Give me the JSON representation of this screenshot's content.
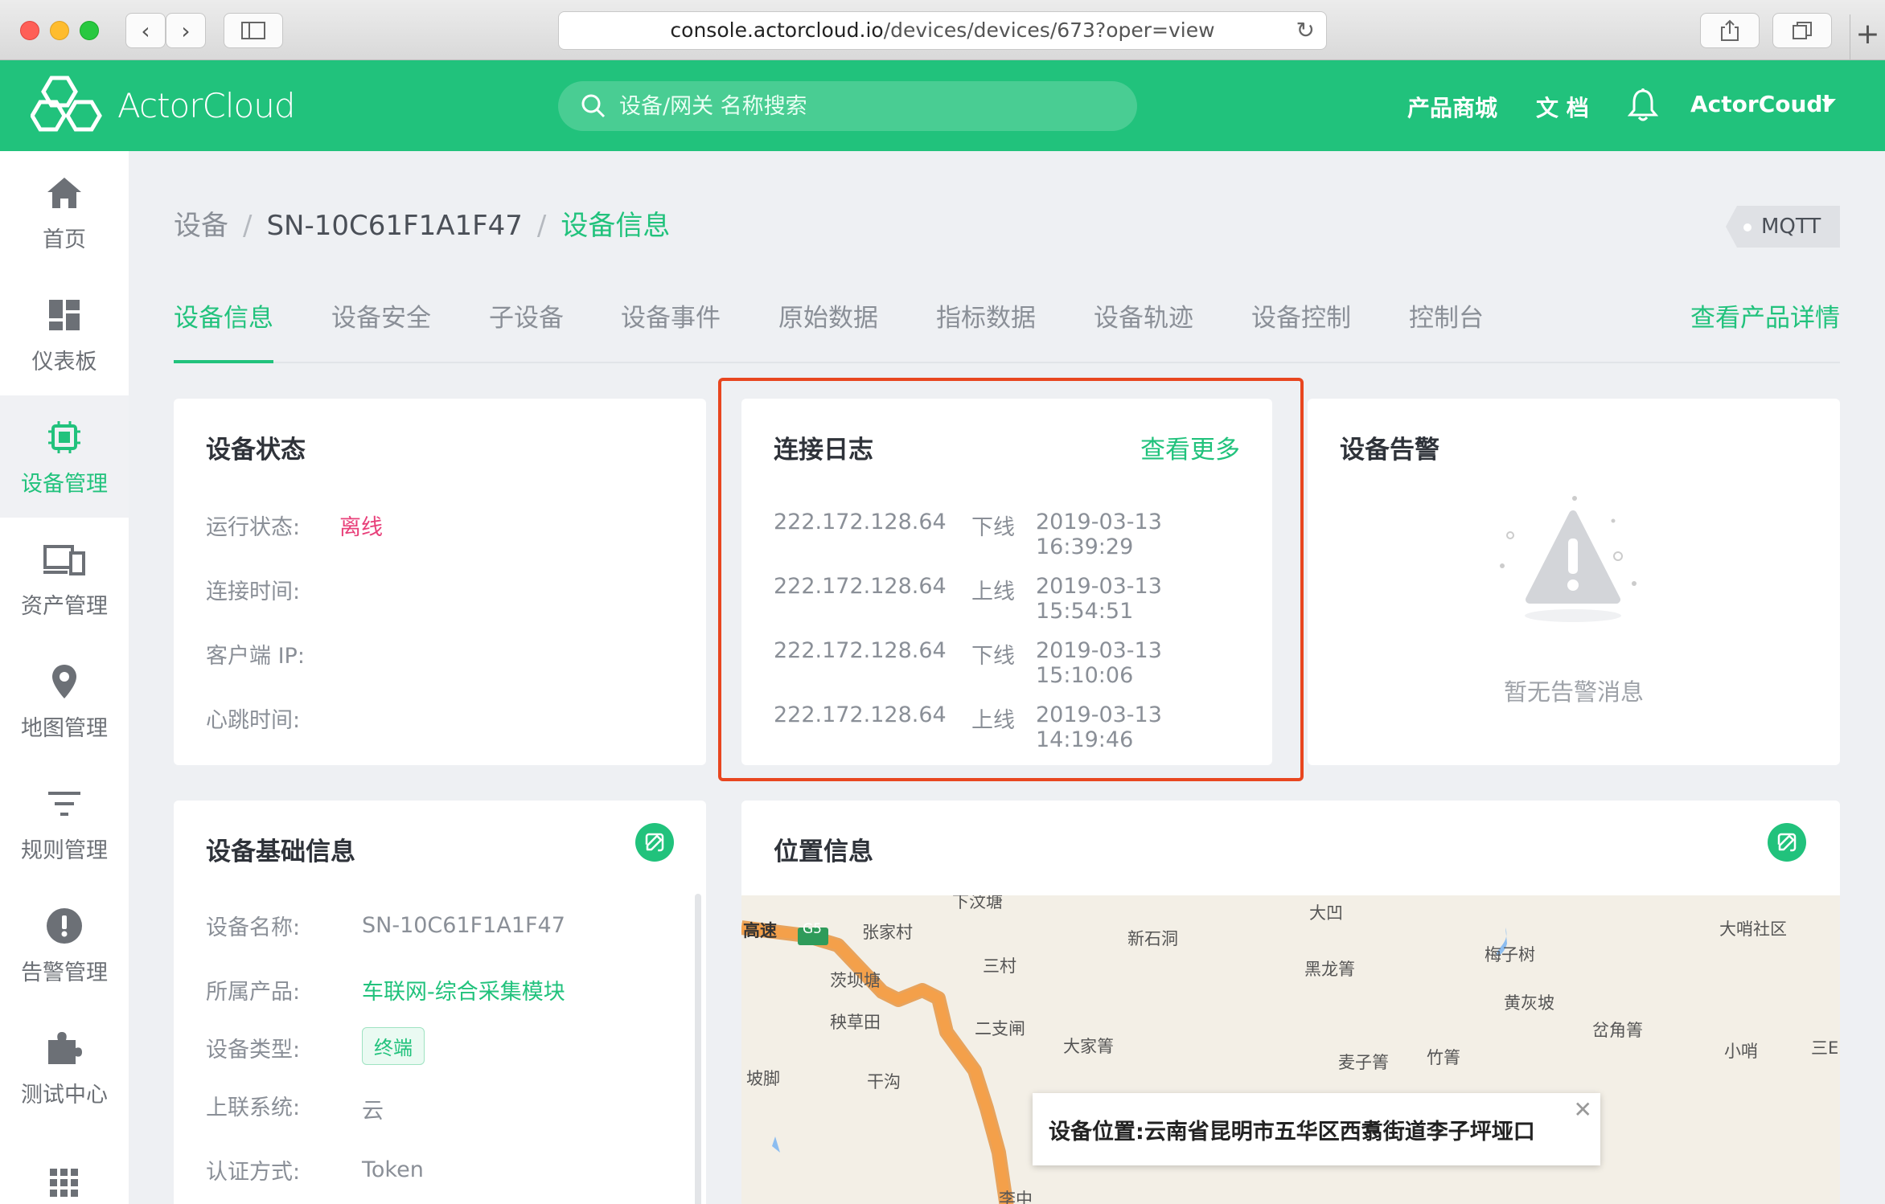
{
  "browser": {
    "url_host": "console.actorcloud.io",
    "url_path": "/devices/devices/673?oper=view"
  },
  "header": {
    "logo_text": "ActorCloud",
    "search_placeholder": "设备/网关 名称搜索",
    "links": [
      "产品商城",
      "文 档"
    ],
    "username": "ActorCoudl"
  },
  "sidebar": {
    "items": [
      {
        "label": "首页",
        "icon": "home-icon"
      },
      {
        "label": "仪表板",
        "icon": "dashboard-icon"
      },
      {
        "label": "设备管理",
        "icon": "chip-icon"
      },
      {
        "label": "资产管理",
        "icon": "devices-icon"
      },
      {
        "label": "地图管理",
        "icon": "map-pin-icon"
      },
      {
        "label": "规则管理",
        "icon": "filter-icon"
      },
      {
        "label": "告警管理",
        "icon": "alert-icon"
      },
      {
        "label": "测试中心",
        "icon": "puzzle-icon"
      },
      {
        "label": "",
        "icon": "grid-icon"
      }
    ]
  },
  "breadcrumb": {
    "root": "设备",
    "sep": "/",
    "device": "SN-10C61F1A1F47",
    "current": "设备信息"
  },
  "protocol_badge": "MQTT",
  "tabs": [
    "设备信息",
    "设备安全",
    "子设备",
    "设备事件",
    "原始数据",
    "指标数据",
    "设备轨迹",
    "设备控制",
    "控制台"
  ],
  "tab_right": "查看产品详情",
  "status_card": {
    "title": "设备状态",
    "rows": [
      {
        "label": "运行状态:",
        "value": "离线"
      },
      {
        "label": "连接时间:",
        "value": ""
      },
      {
        "label": "客户端 IP:",
        "value": ""
      },
      {
        "label": "心跳时间:",
        "value": ""
      }
    ]
  },
  "log_card": {
    "title": "连接日志",
    "more": "查看更多",
    "rows": [
      {
        "ip": "222.172.128.64",
        "status": "下线",
        "time": "2019-03-13 16:39:29"
      },
      {
        "ip": "222.172.128.64",
        "status": "上线",
        "time": "2019-03-13 15:54:51"
      },
      {
        "ip": "222.172.128.64",
        "status": "下线",
        "time": "2019-03-13 15:10:06"
      },
      {
        "ip": "222.172.128.64",
        "status": "上线",
        "time": "2019-03-13 14:19:46"
      }
    ]
  },
  "alert_card": {
    "title": "设备告警",
    "empty_text": "暂无告警消息"
  },
  "basic_card": {
    "title": "设备基础信息",
    "rows": [
      {
        "label": "设备名称:",
        "value": "SN-10C61F1A1F47"
      },
      {
        "label": "所属产品:",
        "value": "车联网-综合采集模块"
      },
      {
        "label": "设备类型:",
        "value": "终端"
      },
      {
        "label": "上联系统:",
        "value": "云"
      },
      {
        "label": "认证方式:",
        "value": "Token"
      }
    ]
  },
  "location_card": {
    "title": "位置信息",
    "popup_label": "设备位置:",
    "popup_value": "云南省昆明市五华区西翥街道李子坪垭口",
    "map_labels": [
      "下汶塘",
      "大凹",
      "大哨社区",
      "高速",
      "G5",
      "张家村",
      "新石洞",
      "梅子树",
      "三村",
      "黑龙箐",
      "茨坝塘",
      "黄灰坡",
      "秧草田",
      "二支闸",
      "大家箐",
      "岔角箐",
      "小哨",
      "三E",
      "坡脚",
      "干沟",
      "麦子箐",
      "竹箐",
      "李中",
      "塘"
    ]
  },
  "colors": {
    "brand": "#21c27c",
    "offline": "#e8407a",
    "highlight": "#e8461f"
  }
}
